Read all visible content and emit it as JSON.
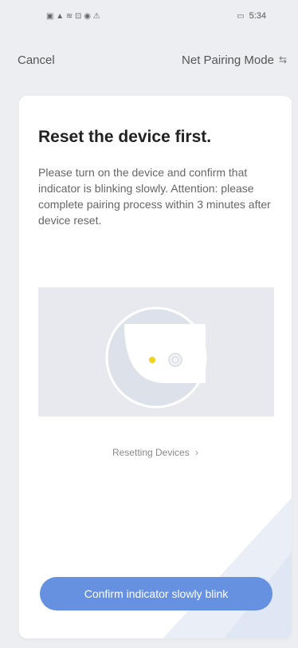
{
  "status_bar": {
    "left_icons": "▣ ▲ ≋ ⊡ ◉ ⚠",
    "right_text": "5:34"
  },
  "nav": {
    "cancel_label": "Cancel",
    "mode_label": "Net Pairing Mode"
  },
  "content": {
    "title": "Reset the device first.",
    "description": "Please turn on the device and confirm that indicator is blinking slowly. Attention: please complete pairing process within 3 minutes after device reset.",
    "reset_link_label": "Resetting Devices",
    "confirm_button_label": "Confirm indicator slowly blink"
  },
  "colors": {
    "button": "#6690e0",
    "indicator": "#f2d21b"
  }
}
